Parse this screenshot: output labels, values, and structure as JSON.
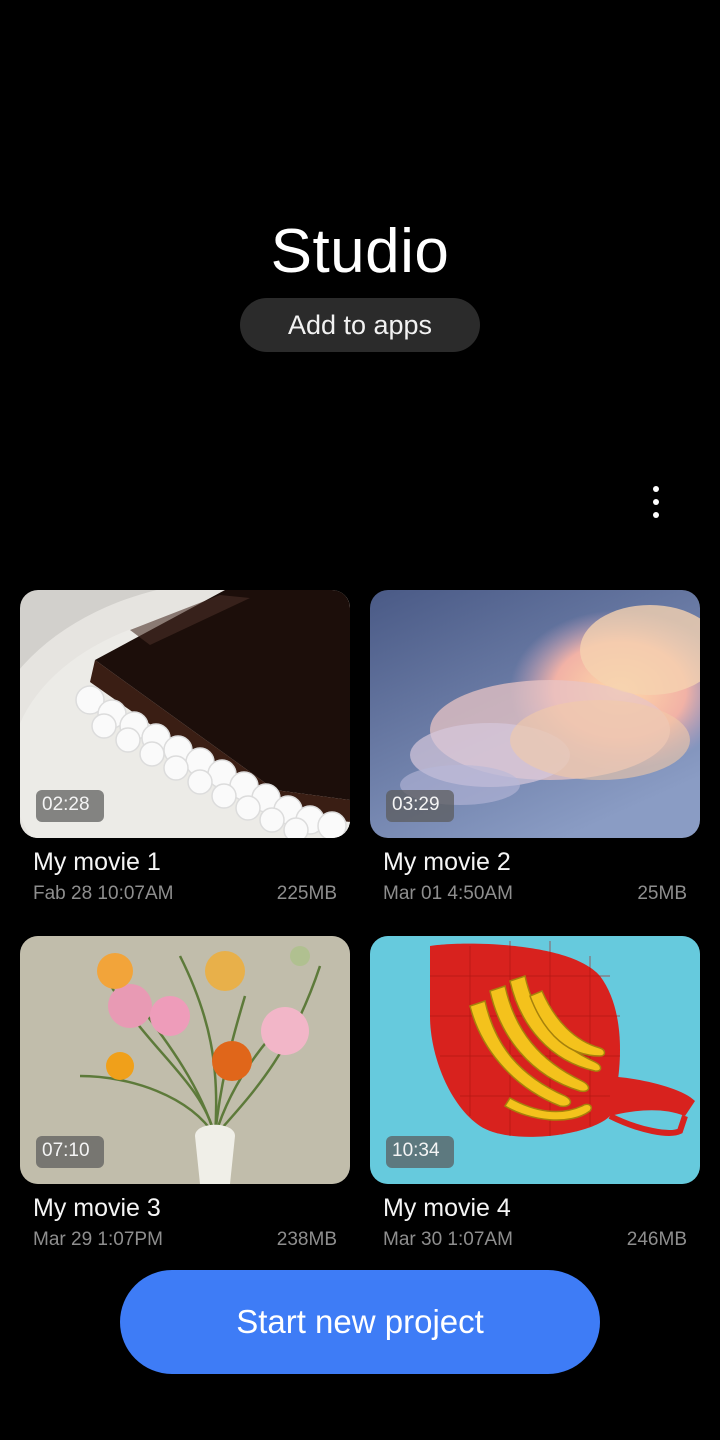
{
  "header": {
    "title": "Studio",
    "add_to_apps": "Add to apps"
  },
  "menu": {
    "icon": "more-vertical-icon"
  },
  "projects": [
    {
      "name": "My movie 1",
      "date": "Fab 28 10:07AM",
      "size": "225MB",
      "duration": "02:28",
      "thumbnail": "chocolate-cake"
    },
    {
      "name": "My movie 2",
      "date": "Mar 01 4:50AM",
      "size": "25MB",
      "duration": "03:29",
      "thumbnail": "clouds"
    },
    {
      "name": "My movie 3",
      "date": "Mar 29 1:07PM",
      "size": "238MB",
      "duration": "07:10",
      "thumbnail": "flowers"
    },
    {
      "name": "My movie 4",
      "date": "Mar 30 1:07AM",
      "size": "246MB",
      "duration": "10:34",
      "thumbnail": "bananas"
    }
  ],
  "footer": {
    "start_new_project": "Start new project"
  },
  "colors": {
    "background": "#000000",
    "accent": "#3e7cf6",
    "pill": "#2b2b2b"
  }
}
